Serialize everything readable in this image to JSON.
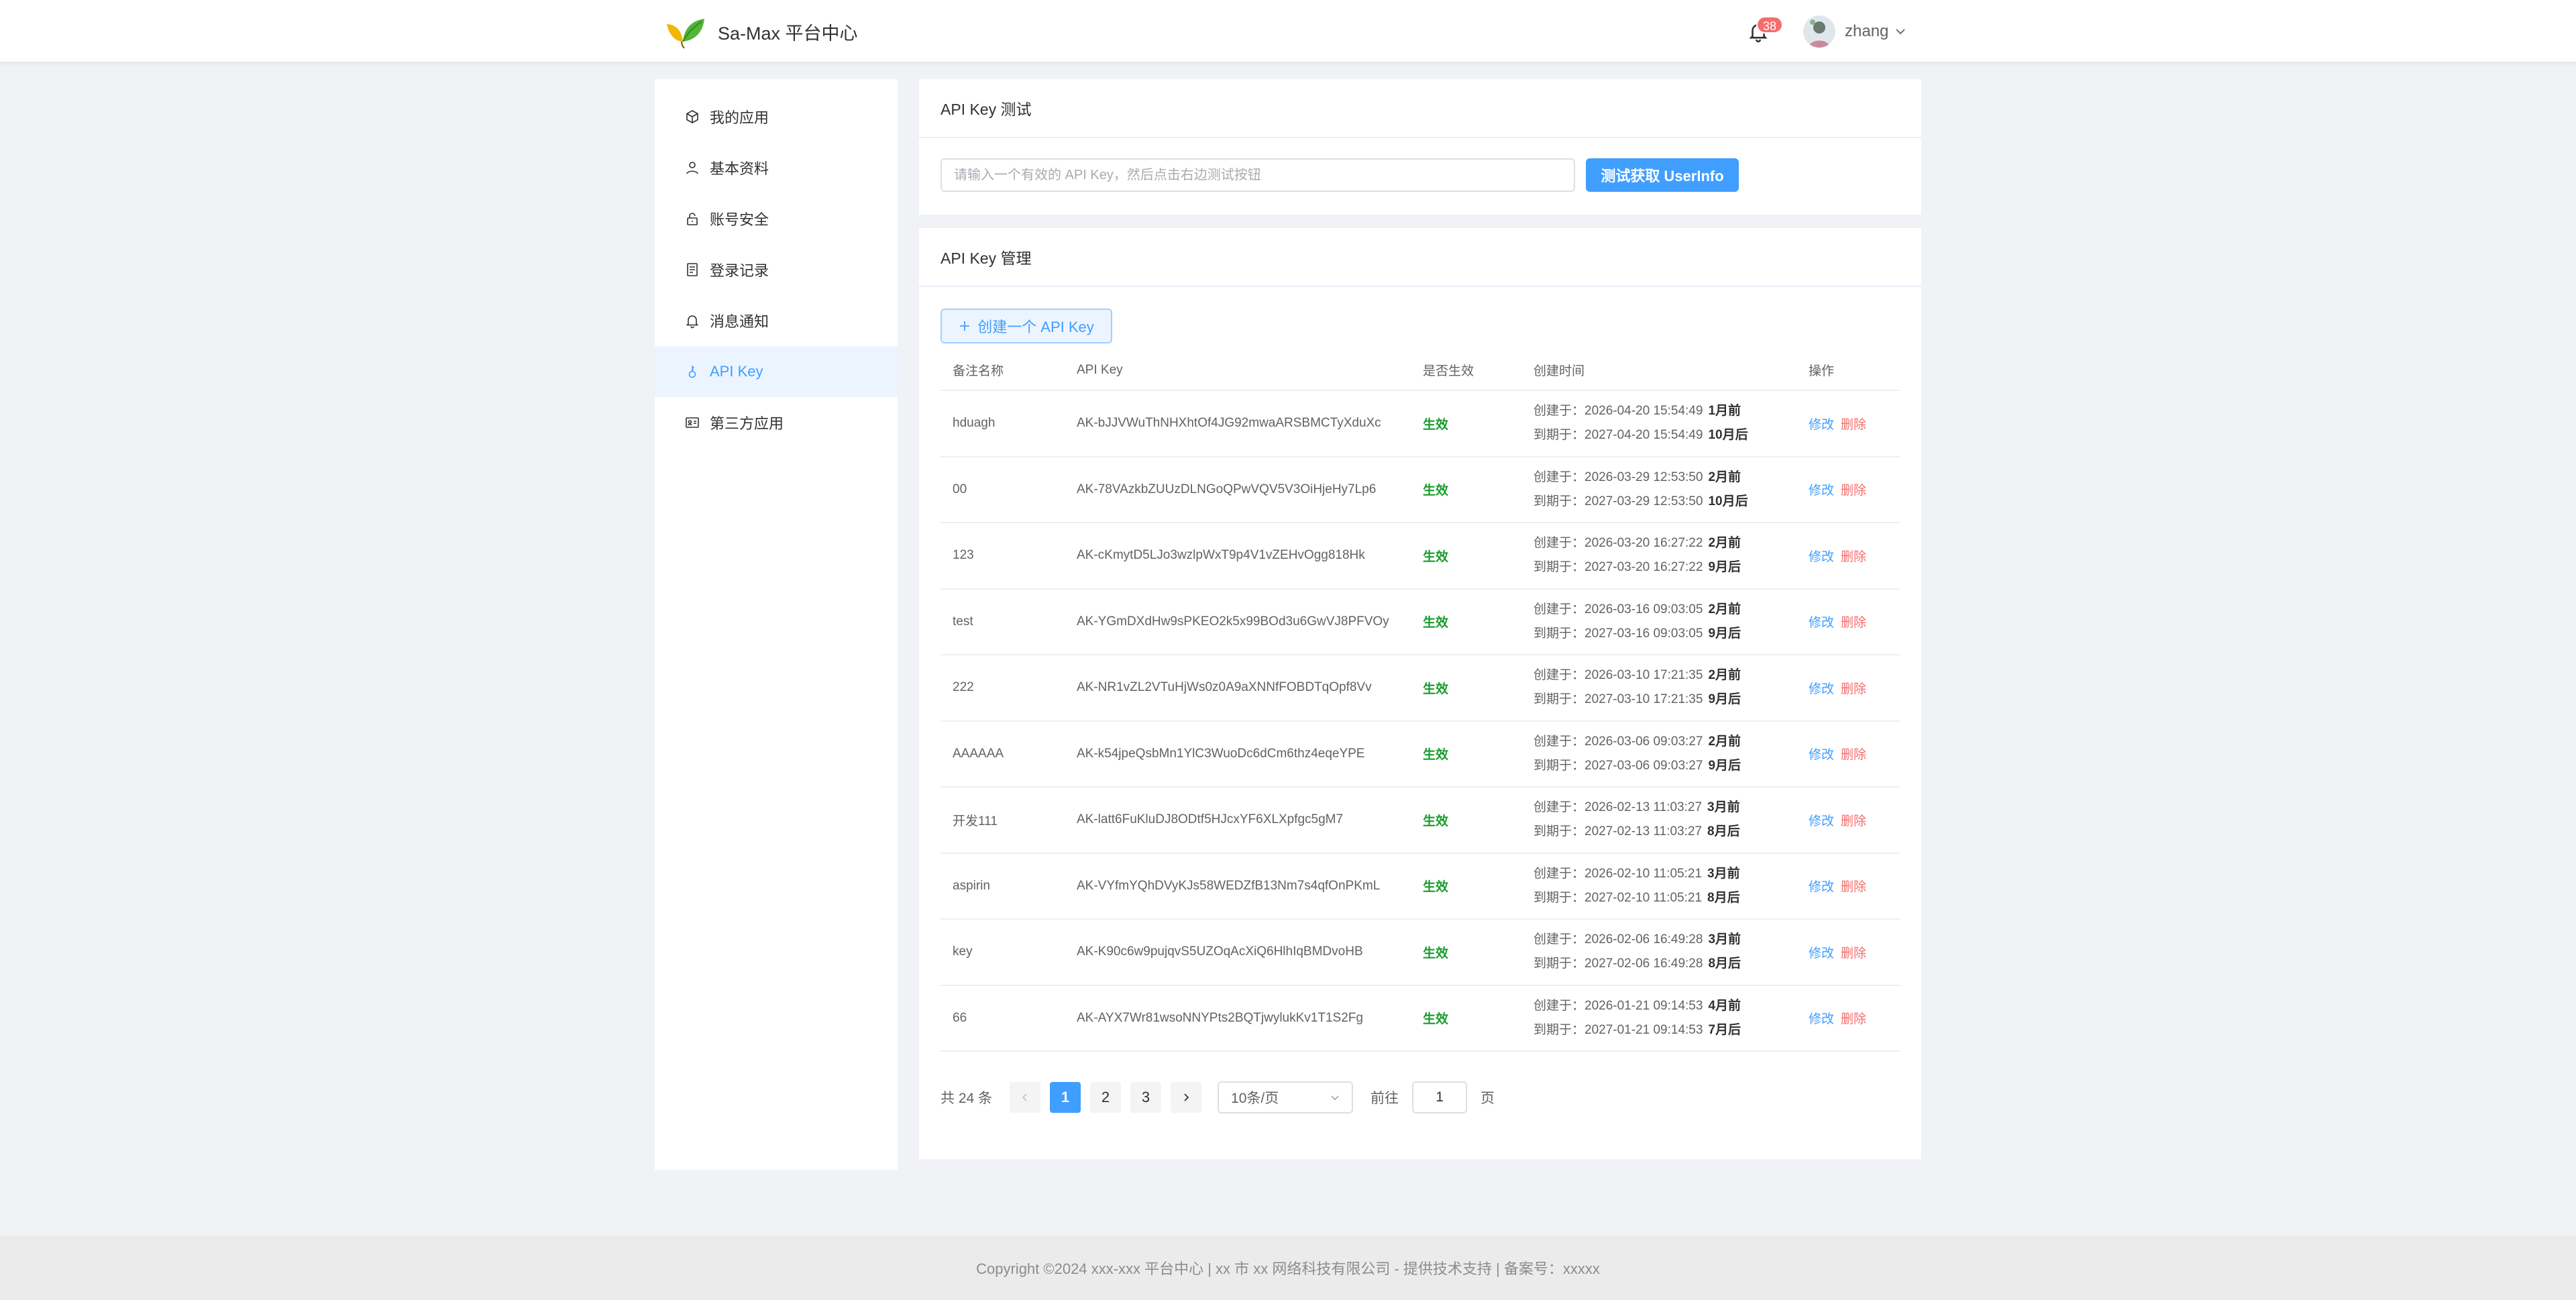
{
  "header": {
    "brand_title": "Sa-Max 平台中心",
    "notification_count": "38",
    "username": "zhang"
  },
  "sidebar": {
    "items": [
      {
        "label": "我的应用",
        "icon": "app-icon",
        "active": false
      },
      {
        "label": "基本资料",
        "icon": "user-icon",
        "active": false
      },
      {
        "label": "账号安全",
        "icon": "lock-icon",
        "active": false
      },
      {
        "label": "登录记录",
        "icon": "document-icon",
        "active": false
      },
      {
        "label": "消息通知",
        "icon": "bell-icon",
        "active": false
      },
      {
        "label": "API Key",
        "icon": "key-icon",
        "active": true
      },
      {
        "label": "第三方应用",
        "icon": "card-icon",
        "active": false
      }
    ]
  },
  "test_card": {
    "title": "API Key 测试",
    "input_placeholder": "请输入一个有效的 API Key，然后点击右边测试按钮",
    "input_value": "",
    "button_label": "测试获取 UserInfo"
  },
  "manage_card": {
    "title": "API Key 管理",
    "create_button_label": "创建一个 API Key",
    "columns": [
      "备注名称",
      "API Key",
      "是否生效",
      "创建时间",
      "操作"
    ],
    "created_prefix": "创建于：",
    "expire_prefix": "到期于：",
    "edit_label": "修改",
    "delete_label": "删除",
    "rows": [
      {
        "name": "hduagh",
        "key": "AK-bJJVWuThNHXhtOf4JG92mwaARSBMCTyXduXc",
        "status": "生效",
        "created": "2026-04-20 15:54:49",
        "created_rel": "1月前",
        "expires": "2027-04-20 15:54:49",
        "expires_rel": "10月后"
      },
      {
        "name": "00",
        "key": "AK-78VAzkbZUUzDLNGoQPwVQV5V3OiHjeHy7Lp6",
        "status": "生效",
        "created": "2026-03-29 12:53:50",
        "created_rel": "2月前",
        "expires": "2027-03-29 12:53:50",
        "expires_rel": "10月后"
      },
      {
        "name": "123",
        "key": "AK-cKmytD5LJo3wzlpWxT9p4V1vZEHvOgg818Hk",
        "status": "生效",
        "created": "2026-03-20 16:27:22",
        "created_rel": "2月前",
        "expires": "2027-03-20 16:27:22",
        "expires_rel": "9月后"
      },
      {
        "name": "test",
        "key": "AK-YGmDXdHw9sPKEO2k5x99BOd3u6GwVJ8PFVOy",
        "status": "生效",
        "created": "2026-03-16 09:03:05",
        "created_rel": "2月前",
        "expires": "2027-03-16 09:03:05",
        "expires_rel": "9月后"
      },
      {
        "name": "222",
        "key": "AK-NR1vZL2VTuHjWs0z0A9aXNNfFOBDTqOpf8Vv",
        "status": "生效",
        "created": "2026-03-10 17:21:35",
        "created_rel": "2月前",
        "expires": "2027-03-10 17:21:35",
        "expires_rel": "9月后"
      },
      {
        "name": "AAAAAA",
        "key": "AK-k54jpeQsbMn1YlC3WuoDc6dCm6thz4eqeYPE",
        "status": "生效",
        "created": "2026-03-06 09:03:27",
        "created_rel": "2月前",
        "expires": "2027-03-06 09:03:27",
        "expires_rel": "9月后"
      },
      {
        "name": "开发111",
        "key": "AK-latt6FuKluDJ8ODtf5HJcxYF6XLXpfgc5gM7",
        "status": "生效",
        "created": "2026-02-13 11:03:27",
        "created_rel": "3月前",
        "expires": "2027-02-13 11:03:27",
        "expires_rel": "8月后"
      },
      {
        "name": "aspirin",
        "key": "AK-VYfmYQhDVyKJs58WEDZfB13Nm7s4qfOnPKmL",
        "status": "生效",
        "created": "2026-02-10 11:05:21",
        "created_rel": "3月前",
        "expires": "2027-02-10 11:05:21",
        "expires_rel": "8月后"
      },
      {
        "name": "key",
        "key": "AK-K90c6w9pujqvS5UZOqAcXiQ6HlhIqBMDvoHB",
        "status": "生效",
        "created": "2026-02-06 16:49:28",
        "created_rel": "3月前",
        "expires": "2027-02-06 16:49:28",
        "expires_rel": "8月后"
      },
      {
        "name": "66",
        "key": "AK-AYX7Wr81wsoNNYPts2BQTjwylukKv1T1S2Fg",
        "status": "生效",
        "created": "2026-01-21 09:14:53",
        "created_rel": "4月前",
        "expires": "2027-01-21 09:14:53",
        "expires_rel": "7月后"
      }
    ]
  },
  "pagination": {
    "total_text": "共 24 条",
    "pages": [
      "1",
      "2",
      "3"
    ],
    "current_page": "1",
    "page_size": "10条/页",
    "goto_prefix": "前往",
    "goto_value": "1",
    "goto_suffix": "页"
  },
  "footer": {
    "text": "Copyright ©2024 xxx-xxx 平台中心 | xx 市 xx 网络科技有限公司 - 提供技术支持 | 备案号：xxxxx"
  },
  "colors": {
    "primary": "#409eff",
    "danger": "#f56c6c",
    "success": "#1a9c2e",
    "active_menu_bg": "#ecf5ff"
  }
}
